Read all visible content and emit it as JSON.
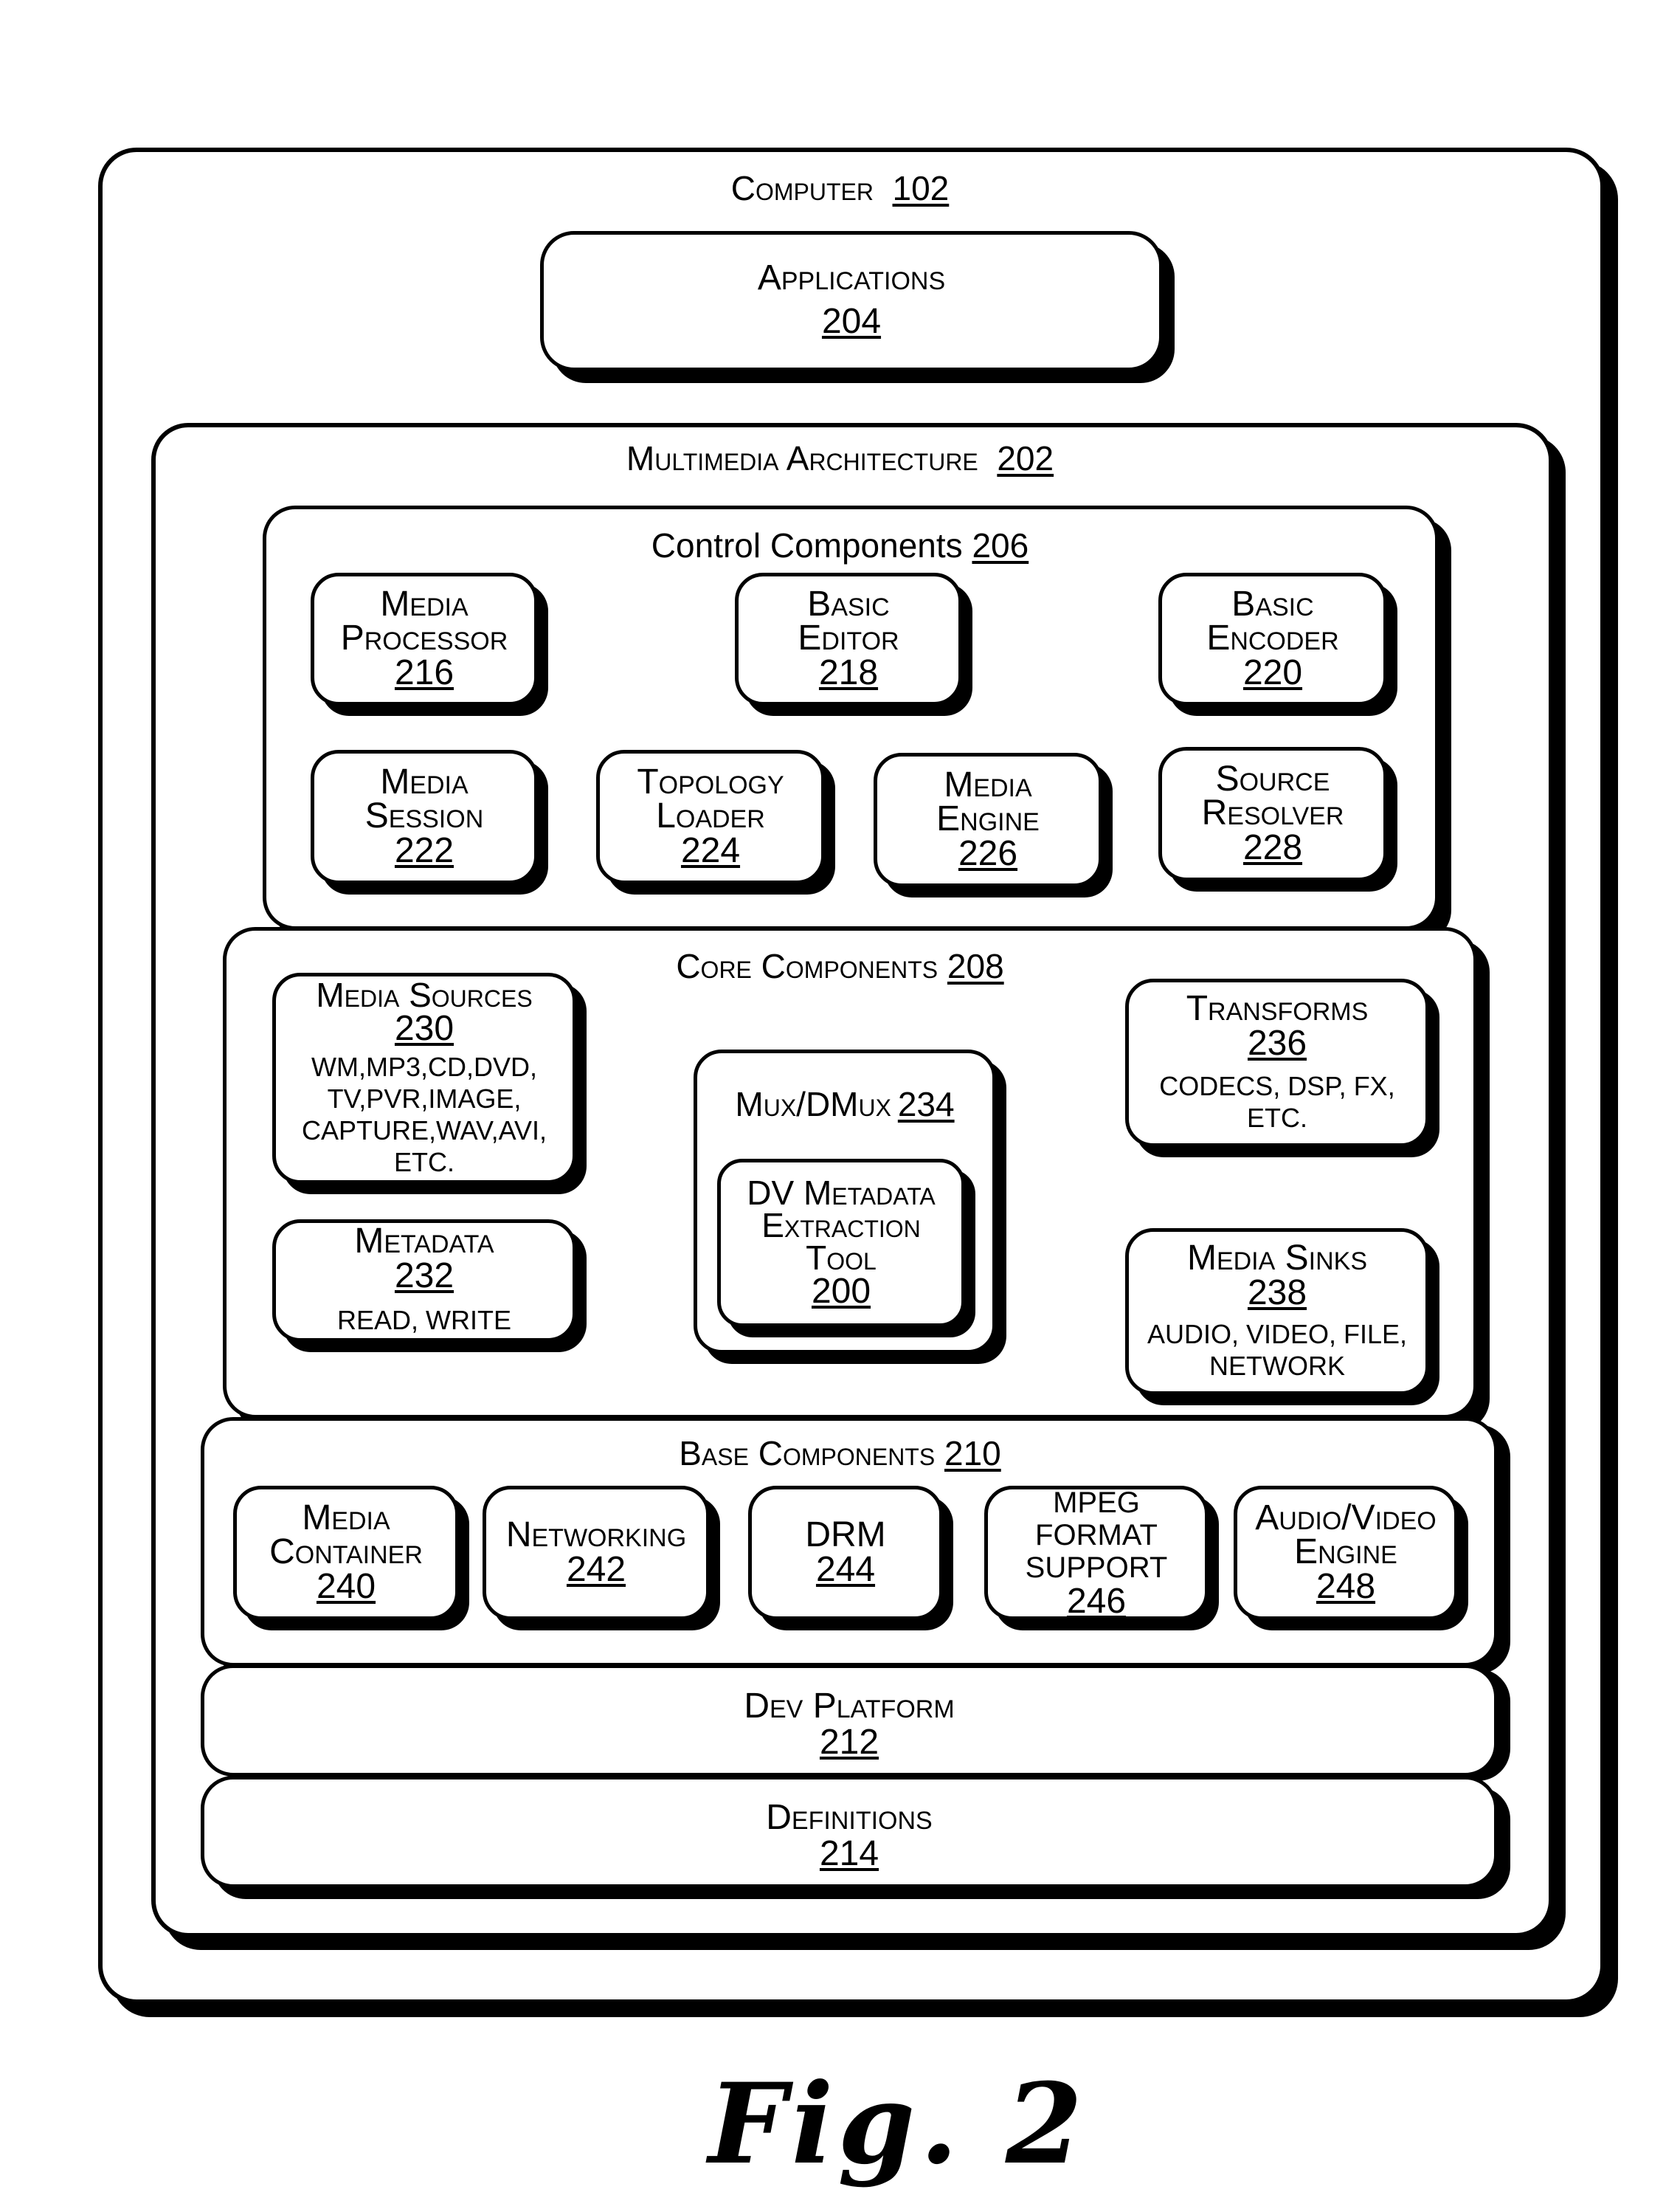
{
  "figure": {
    "caption": "Fig. 2",
    "computer": {
      "label": "Computer",
      "ref": "102"
    },
    "applications": {
      "label": "Applications",
      "ref": "204"
    },
    "multimedia_architecture": {
      "label": "Multimedia Architecture",
      "ref": "202"
    },
    "control_components": {
      "label": "Control Components",
      "ref": "206",
      "items": [
        {
          "label": "Media\nProcessor",
          "ref": "216"
        },
        {
          "label": "Basic\nEditor",
          "ref": "218"
        },
        {
          "label": "Basic\nEncoder",
          "ref": "220"
        },
        {
          "label": "Media\nSession",
          "ref": "222"
        },
        {
          "label": "Topology\nLoader",
          "ref": "224"
        },
        {
          "label": "Media\nEngine",
          "ref": "226"
        },
        {
          "label": "Source\nResolver",
          "ref": "228"
        }
      ]
    },
    "core_components": {
      "label": "Core Components",
      "ref": "208",
      "media_sources": {
        "label": "Media Sources",
        "ref": "230",
        "detail": "WM,MP3,CD,DVD,\nTV,PVR,IMAGE,\nCAPTURE,WAV,AVI,\nETC."
      },
      "metadata": {
        "label": "Metadata",
        "ref": "232",
        "detail": "READ, WRITE"
      },
      "mux_dmux": {
        "label": "Mux/DMux",
        "ref": "234"
      },
      "dv_tool": {
        "label": "DV Metadata\nExtraction\nTool",
        "ref": "200"
      },
      "transforms": {
        "label": "Transforms",
        "ref": "236",
        "detail": "CODECS, DSP, FX,\nETC."
      },
      "media_sinks": {
        "label": "Media Sinks",
        "ref": "238",
        "detail": "AUDIO, VIDEO, FILE,\nNETWORK"
      }
    },
    "base_components": {
      "label": "Base Components",
      "ref": "210",
      "items": [
        {
          "label": "Media\nContainer",
          "ref": "240"
        },
        {
          "label": "Networking",
          "ref": "242"
        },
        {
          "label": "DRM",
          "ref": "244"
        },
        {
          "label": "MPEG FORMAT\nSUPPORT",
          "ref": "246"
        },
        {
          "label": "Audio/Video\nEngine",
          "ref": "248"
        }
      ]
    },
    "dev_platform": {
      "label": "Dev Platform",
      "ref": "212"
    },
    "definitions": {
      "label": "Definitions",
      "ref": "214"
    }
  }
}
